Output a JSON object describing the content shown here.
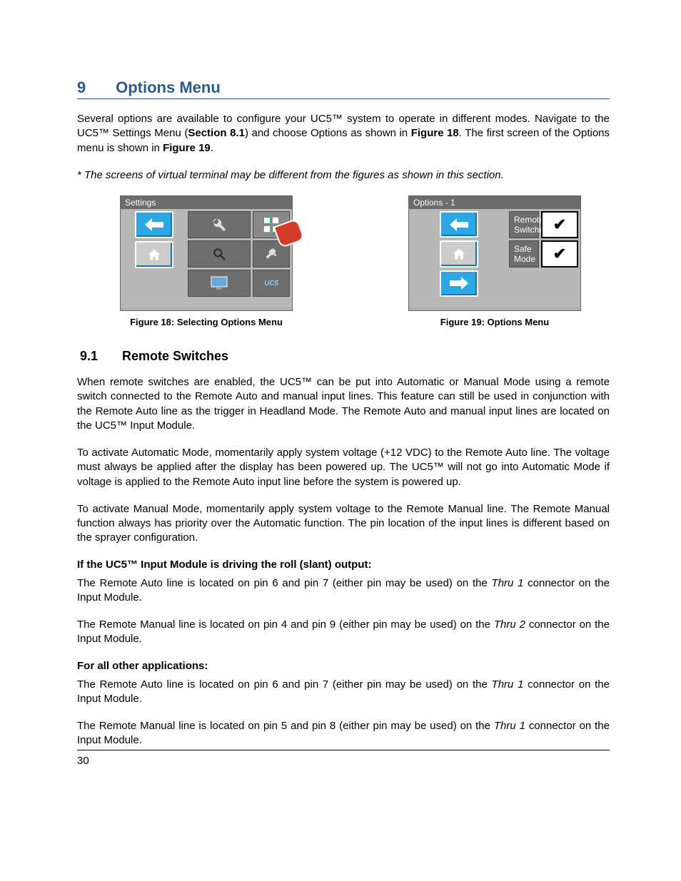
{
  "heading": {
    "number": "9",
    "title": "Options Menu"
  },
  "intro": {
    "p1a": "Several options are available to configure your UC5™ system to operate in different modes. Navigate to the UC5™ Settings Menu (",
    "p1b": "Section 8.1",
    "p1c": ") and choose Options as shown in ",
    "p1d": "Figure 18",
    "p1e": ". The first screen of the Options menu is shown in ",
    "p1f": "Figure 19",
    "p1g": "."
  },
  "note": "* The screens of virtual terminal may be different from the figures as shown in this section.",
  "fig18": {
    "header": "Settings",
    "caption": "Figure 18: Selecting Options Menu",
    "uc5_label": "UC5"
  },
  "fig19": {
    "header": "Options - 1",
    "row1": "Remote Switches",
    "row2": "Safe Mode",
    "caption": "Figure 19: Options Menu",
    "check": "✔"
  },
  "sec91": {
    "num": "9.1",
    "title": "Remote Switches",
    "p1": "When remote switches are enabled, the UC5™ can be put into Automatic or Manual Mode using a remote switch connected to the Remote Auto and manual input lines.  This feature can still be used in conjunction with the Remote Auto line as the trigger in Headland Mode.  The Remote Auto and manual input lines are located on the UC5™ Input Module.",
    "p2": "To activate Automatic Mode, momentarily apply system voltage (+12 VDC) to the Remote Auto line.  The voltage must always be applied after the display has been powered up.  The UC5™ will not go into Automatic Mode if voltage is applied to the Remote Auto input line before the system is powered up.",
    "p3": "To activate Manual Mode, momentarily apply system voltage to the Remote Manual line.  The Remote Manual function always has priority over the Automatic function.  The pin location of the input lines is different based on the sprayer configuration.",
    "sub1": "If the UC5™ Input Module is driving the roll (slant) output:",
    "p4a": "The Remote Auto line is located on pin 6 and pin 7 (either pin may be used) on the ",
    "p4b": "Thru 1",
    "p4c": " connector on the Input Module.",
    "p5a": "The Remote Manual line is located on pin 4 and pin 9 (either pin may be used) on the ",
    "p5b": "Thru 2",
    "p5c": " connector on the Input Module.",
    "sub2": "For all other applications:",
    "p6a": "The Remote Auto line is located on pin 6 and pin 7 (either pin may be used) on the ",
    "p6b": "Thru 1",
    "p6c": " connector on the Input Module.",
    "p7a": "The Remote Manual line is located on pin 5 and pin 8 (either pin may be used) on the ",
    "p7b": "Thru 1",
    "p7c": " connector on the Input Module."
  },
  "page_number": "30"
}
